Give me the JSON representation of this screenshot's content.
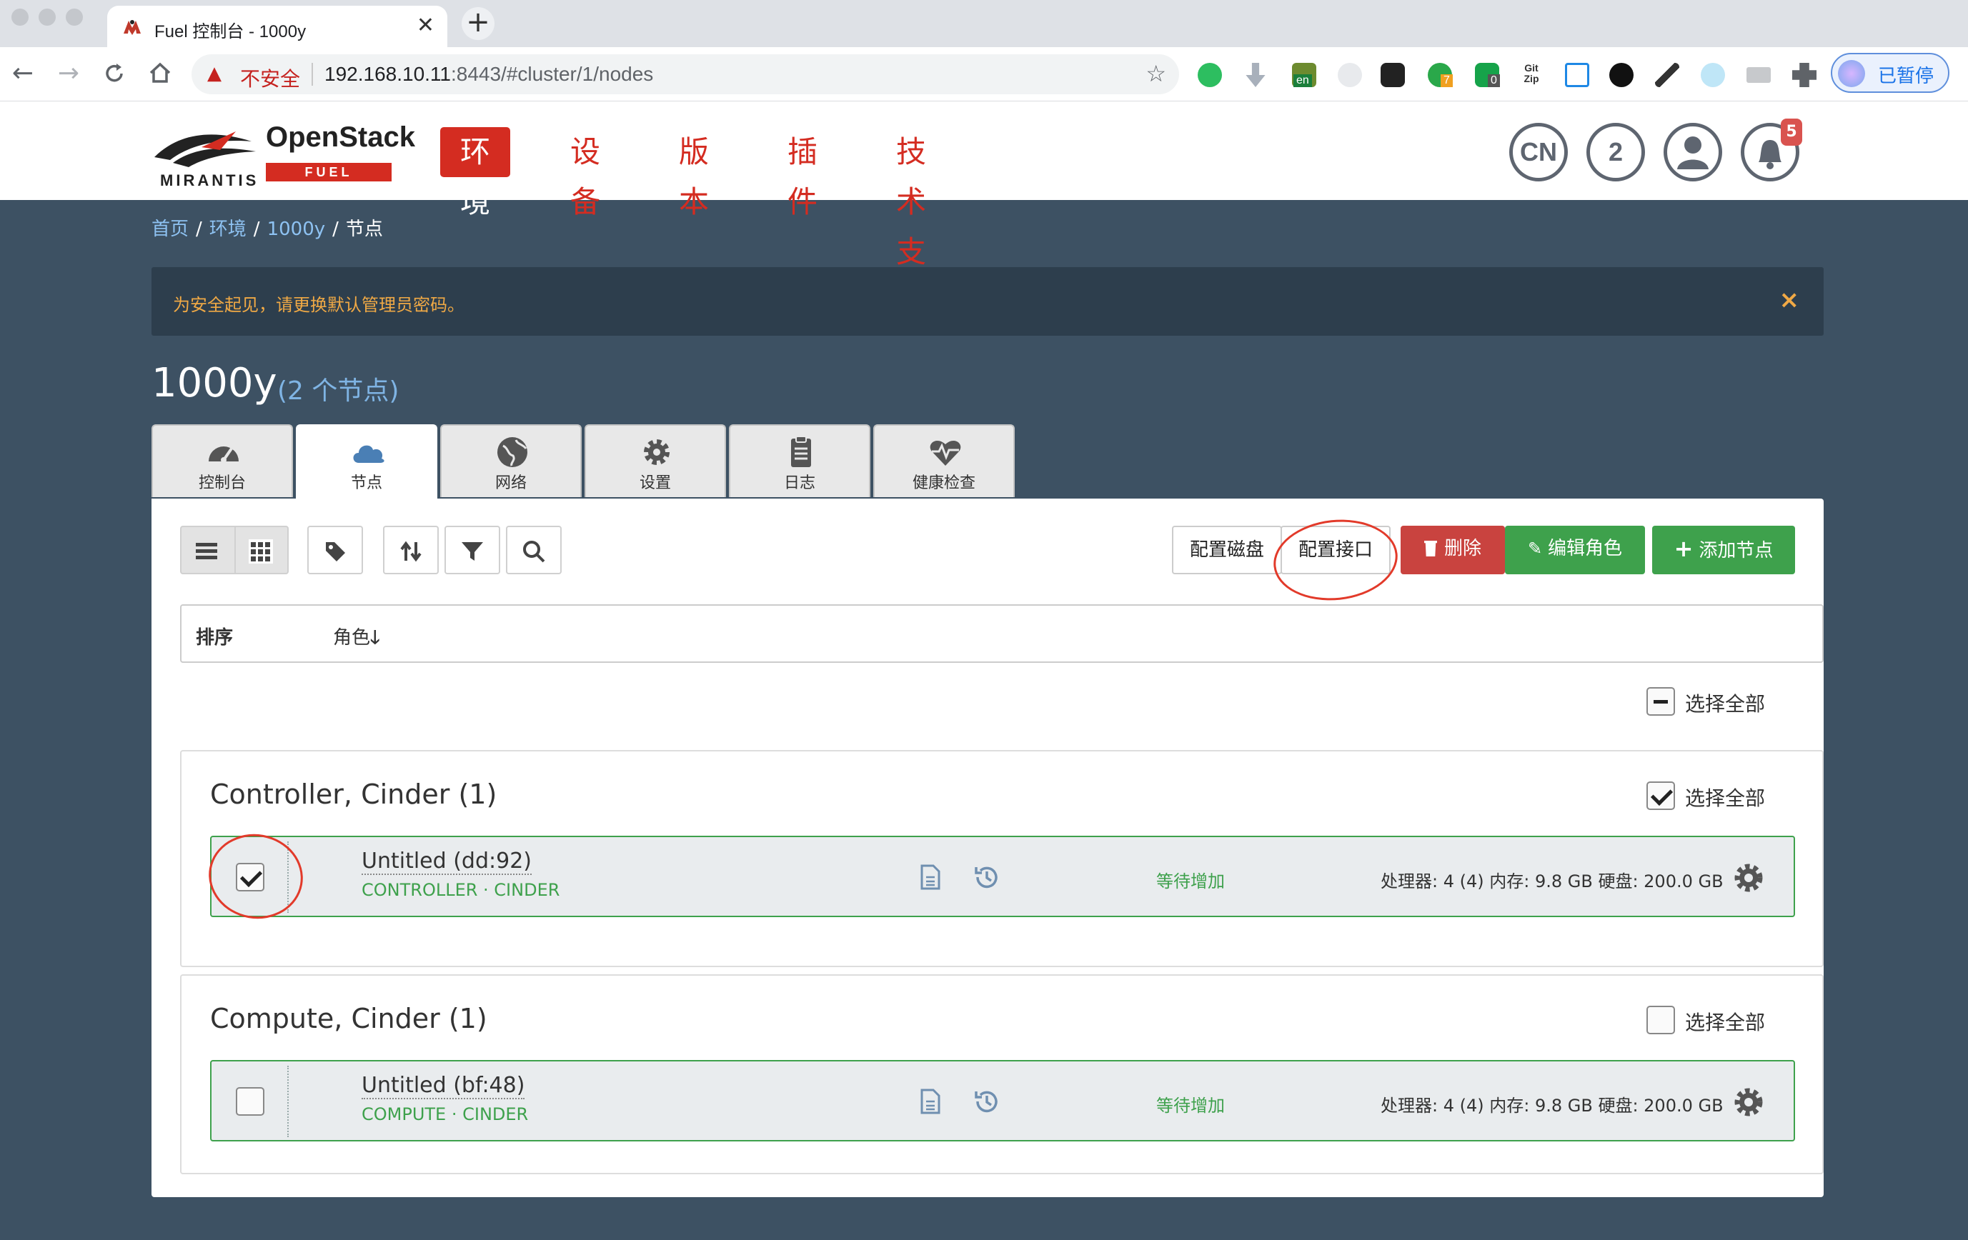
{
  "browser": {
    "tab_title": "Fuel 控制台 - 1000y",
    "tab_close": "✕",
    "new_tab": "+",
    "security_label": "不安全",
    "url_host": "192.168.10.11",
    "url_path": ":8443/#cluster/1/nodes",
    "profile_label": "已暂停",
    "ext_badges": [
      "en",
      "7",
      "0"
    ],
    "ext_gitzip": "Git Zip"
  },
  "app": {
    "logo_company": "MIRANTIS",
    "logo_product": "OpenStack",
    "logo_sub": "FUEL",
    "nav": [
      "环境",
      "设备",
      "版本",
      "插件",
      "技术支持"
    ],
    "lang": "CN",
    "count_circle": "2",
    "notification_count": "5"
  },
  "breadcrumb": [
    "首页",
    "环境",
    "1000y",
    "节点"
  ],
  "alert": {
    "text": "为安全起见，请更换默认管理员密码。",
    "close": "×"
  },
  "cluster": {
    "name": "1000y",
    "node_count": "(2 个节点)"
  },
  "tabs": [
    "控制台",
    "节点",
    "网络",
    "设置",
    "日志",
    "健康检查"
  ],
  "actions": {
    "config_disks": "配置磁盘",
    "config_interfaces": "配置接口",
    "delete": "删除",
    "edit_roles": "编辑角色",
    "add_nodes": "添加节点"
  },
  "sort": {
    "label": "排序",
    "role": "角色"
  },
  "select_all": "选择全部",
  "groups": [
    {
      "title": "Controller, Cinder (1)",
      "checked": true,
      "node": {
        "name": "Untitled (dd:92)",
        "roles": "CONTROLLER · CINDER",
        "status": "等待增加",
        "specs": "处理器: 4 (4)  内存: 9.8 GB  硬盘: 200.0 GB",
        "checked": true
      }
    },
    {
      "title": "Compute, Cinder (1)",
      "checked": false,
      "node": {
        "name": "Untitled (bf:48)",
        "roles": "COMPUTE · CINDER",
        "status": "等待增加",
        "specs": "处理器: 4 (4)  内存: 9.8 GB  硬盘: 200.0 GB",
        "checked": false
      }
    }
  ],
  "colors": {
    "brand_red": "#d42c21",
    "success_green": "#3ea14c",
    "danger_red": "#c9433f",
    "page_bg": "#3d5163"
  }
}
